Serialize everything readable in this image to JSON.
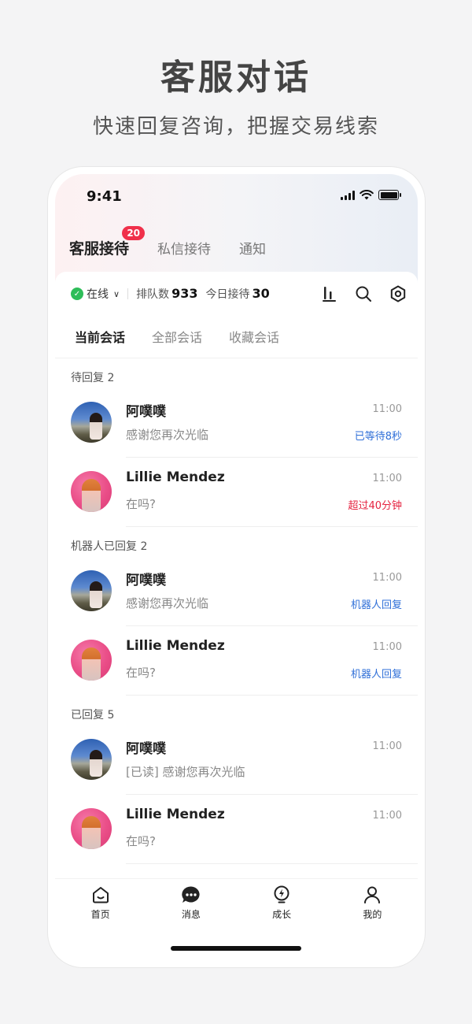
{
  "hero": {
    "title": "客服对话",
    "subtitle": "快速回复咨询，把握交易线索"
  },
  "status_bar": {
    "time": "9:41"
  },
  "main_tabs": [
    {
      "label": "客服接待",
      "badge": "20",
      "active": true
    },
    {
      "label": "私信接待"
    },
    {
      "label": "通知"
    }
  ],
  "toolbar": {
    "status": "在线",
    "queue_label": "排队数",
    "queue_value": "933",
    "today_label": "今日接待",
    "today_value": "30",
    "icons": [
      "stats-icon",
      "search-icon",
      "settings-icon"
    ]
  },
  "sub_tabs": [
    {
      "label": "当前会话",
      "active": true
    },
    {
      "label": "全部会话"
    },
    {
      "label": "收藏会话"
    }
  ],
  "sections": [
    {
      "label": "待回复 2",
      "items": [
        {
          "name": "阿噗噗",
          "message": "感谢您再次光临",
          "time": "11:00",
          "status": "已等待8秒",
          "status_color": "#2f6fd8"
        },
        {
          "name": "Lillie Mendez",
          "message": "在吗?",
          "time": "11:00",
          "status": "超过40分钟",
          "status_color": "#e5223f"
        }
      ]
    },
    {
      "label": "机器人已回复 2",
      "items": [
        {
          "name": "阿噗噗",
          "message": "感谢您再次光临",
          "time": "11:00",
          "status": "机器人回复",
          "status_color": "#2f6fd8"
        },
        {
          "name": "Lillie Mendez",
          "message": "在吗?",
          "time": "11:00",
          "status": "机器人回复",
          "status_color": "#2f6fd8"
        }
      ]
    },
    {
      "label": "已回复 5",
      "items": [
        {
          "name": "阿噗噗",
          "message": "[已读] 感谢您再次光临",
          "time": "11:00",
          "status": ""
        },
        {
          "name": "Lillie Mendez",
          "message": "在吗?",
          "time": "11:00",
          "status": ""
        }
      ]
    }
  ],
  "bottom_nav": [
    {
      "label": "首页",
      "icon": "home-icon"
    },
    {
      "label": "消息",
      "icon": "message-icon"
    },
    {
      "label": "成长",
      "icon": "growth-icon"
    },
    {
      "label": "我的",
      "icon": "profile-icon"
    }
  ],
  "colors": {
    "accent_blue": "#2f6fd8",
    "alert_red": "#e5223f",
    "online_green": "#2ebd59",
    "badge_red": "#f0304a"
  }
}
